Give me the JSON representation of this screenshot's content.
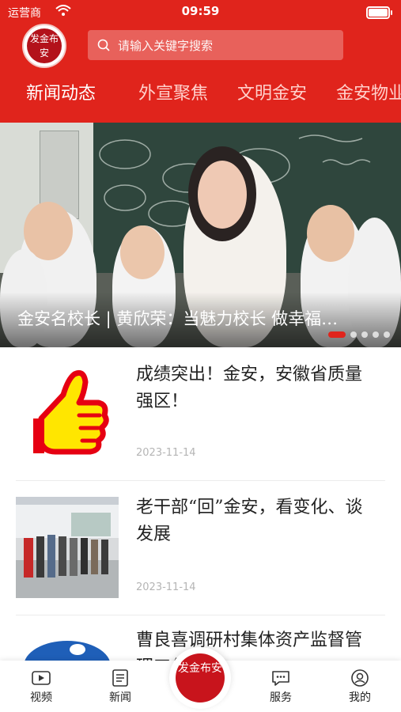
{
  "status_bar": {
    "carrier": "运营商",
    "time": "09:59"
  },
  "header": {
    "logo_text": "发金布安",
    "search": {
      "placeholder": "请输入关键字搜索"
    },
    "tabs": [
      {
        "label": "新闻动态",
        "active": true
      },
      {
        "label": "外宣聚焦",
        "active": false
      },
      {
        "label": "文明金安",
        "active": false
      },
      {
        "label": "金安物业",
        "active": false
      }
    ]
  },
  "banner": {
    "caption": "金安名校长 | 黄欣荣：当魅力校长 做幸福…",
    "dot_count": 5,
    "active_dot": 0
  },
  "news": [
    {
      "title": "成绩突出！金安，安徽省质量强区！",
      "date": "2023-11-14",
      "thumb": "thumbs-up-icon"
    },
    {
      "title": "老干部“回”金安，看变化、谈发展",
      "date": "2023-11-14",
      "thumb": "photo-visit"
    },
    {
      "title": "曹良喜调研村集体资产监督管理工作",
      "date": "",
      "thumb": "blue-emblem"
    }
  ],
  "bottom_nav": {
    "items": [
      {
        "label": "视频",
        "icon": "video-icon"
      },
      {
        "label": "新闻",
        "icon": "news-icon"
      },
      {
        "label": "服务",
        "icon": "chat-icon"
      },
      {
        "label": "我的",
        "icon": "user-icon"
      }
    ],
    "center_logo_text": "发金布安"
  },
  "colors": {
    "brand_red": "#e0241c",
    "dark_red": "#b3121b"
  }
}
